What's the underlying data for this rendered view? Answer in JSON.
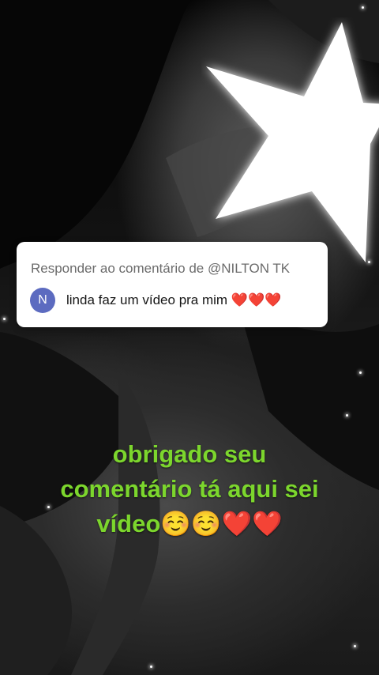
{
  "reply_card": {
    "header": "Responder ao comentário de @NILTON TK",
    "avatar_letter": "N",
    "comment": "linda faz um vídeo pra mim ❤️❤️❤️"
  },
  "caption": {
    "line1": "obrigado seu",
    "line2": "comentário tá aqui sei",
    "line3": "vídeo☺️☺️❤️❤️"
  },
  "colors": {
    "caption": "#7cd62d",
    "avatar": "#5c6bc0",
    "card": "#ffffff",
    "star": "#ffffff"
  },
  "icons": {
    "overlay_sticker": "star-icon",
    "sparkles": "sparkle-icon"
  }
}
